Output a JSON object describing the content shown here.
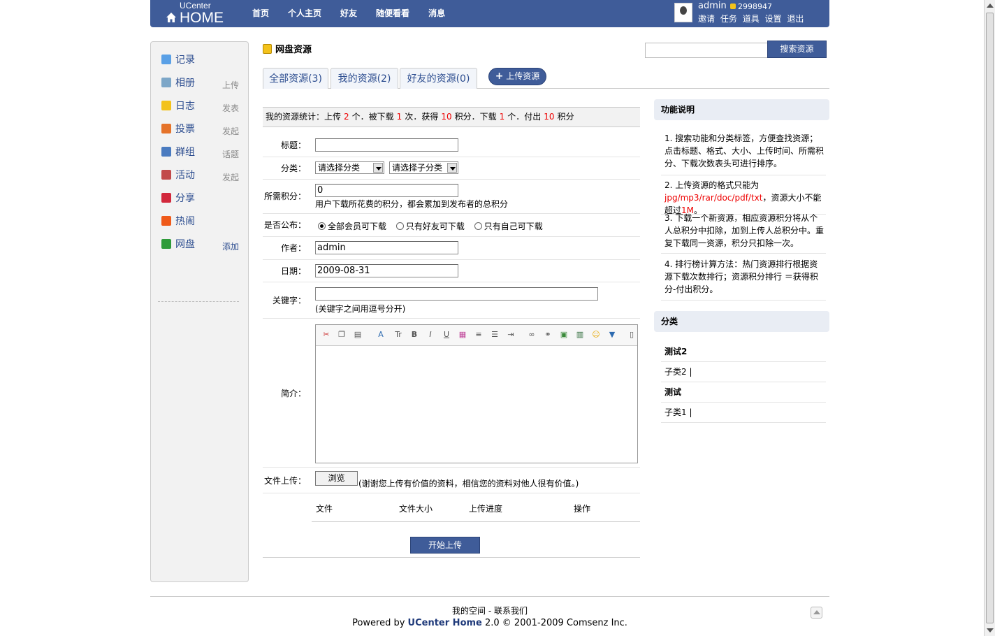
{
  "header": {
    "logo_top": "UCenter",
    "logo_main": "HOME",
    "nav": [
      "首页",
      "个人主页",
      "好友",
      "随便看看",
      "消息"
    ],
    "user": {
      "name": "admin",
      "credits": "2998947",
      "links": [
        "邀请",
        "任务",
        "道具",
        "设置",
        "退出"
      ]
    }
  },
  "sidebar": {
    "items": [
      {
        "label": "记录",
        "action": "",
        "icon": "speech-bubble-icon",
        "color": "#5aa0e6"
      },
      {
        "label": "相册",
        "action": "上传",
        "icon": "photo-album-icon",
        "color": "#7da7c8"
      },
      {
        "label": "日志",
        "action": "发表",
        "icon": "blog-icon",
        "color": "#f3c21b"
      },
      {
        "label": "投票",
        "action": "发起",
        "icon": "poll-chart-icon",
        "color": "#e5732a"
      },
      {
        "label": "群组",
        "action": "话题",
        "icon": "group-icon",
        "color": "#4a7bc0"
      },
      {
        "label": "活动",
        "action": "发起",
        "icon": "calendar-icon",
        "color": "#c24a4a"
      },
      {
        "label": "分享",
        "action": "",
        "icon": "share-hearts-icon",
        "color": "#d2283c"
      },
      {
        "label": "热闹",
        "action": "",
        "icon": "fire-icon",
        "color": "#ef5a1a"
      },
      {
        "label": "网盘",
        "action": "添加",
        "icon": "disk-icon",
        "color": "#2e9b3a"
      }
    ]
  },
  "page": {
    "title": "网盘资源",
    "search_button": "搜索资源",
    "tabs": [
      "全部资源(3)",
      "我的资源(2)",
      "好友的资源(0)"
    ],
    "upload_button": "上传资源"
  },
  "stats": {
    "prefix": "我的资源统计：上传",
    "uploaded": "2",
    "t1": "个．被下载",
    "downloaded_times": "1",
    "t2": "次．获得",
    "earned": "10",
    "t3": "积分．下载",
    "downloads": "1",
    "t4": "个．付出",
    "paid": "10",
    "t5": "积分"
  },
  "form": {
    "title_label": "标题：",
    "title_value": "",
    "category_label": "分类：",
    "category_select": "请选择分类",
    "subcategory_select": "请选择子分类",
    "points_label": "所需积分：",
    "points_value": "0",
    "points_hint": "用户下载所花费的积分，都会累加到发布者的总积分",
    "public_label": "是否公布：",
    "public_options": [
      "全部会员可下载",
      "只有好友可下载",
      "只有自己可下载"
    ],
    "author_label": "作者：",
    "author_value": "admin",
    "date_label": "日期：",
    "date_value": "2009-08-31",
    "keywords_label": "关键字：",
    "keywords_value": "",
    "keywords_hint": "(关键字之间用逗号分开)",
    "intro_label": "简介：",
    "file_label": "文件上传：",
    "browse_button": "浏览",
    "file_hint": "(谢谢您上传有价值的资料，相信您的资料对他人很有价值。)",
    "file_columns": [
      "文件",
      "文件大小",
      "上传进度",
      "操作"
    ],
    "start_button": "开始上传",
    "editor_buttons": [
      "cut-icon",
      "copy-icon",
      "paste-icon",
      "font-family-icon",
      "font-size-icon",
      "bold-icon",
      "italic-icon",
      "underline-icon",
      "color-icon",
      "align-icon",
      "list-icon",
      "indent-icon",
      "link-icon",
      "unlink-icon",
      "image-icon",
      "video-icon",
      "emoticon-icon",
      "save-icon",
      "source-icon"
    ]
  },
  "right": {
    "help_title": "功能说明",
    "notes": [
      "1. 搜索功能和分类标签，方便查找资源；点击标题、格式、大小、上传时间、所需积分、下载次数表头可进行排序。",
      "3. 下载一个新资源，相应资源积分将从个人总积分中扣除，加到上传人总积分中。重复下载同一资源，积分只扣除一次。",
      "4. 排行榜计算方法：热门资源排行根据资源下载次数排行；资源积分排行 ＝获得积分-付出积分。"
    ],
    "note2_a": "2. 上传资源的格式只能为",
    "note2_red1": "jpg/mp3/rar/doc/pdf/txt",
    "note2_b": "，资源大小不能超过",
    "note2_red2": "1M",
    "note2_c": "。",
    "category_title": "分类",
    "categories": [
      {
        "name": "测试2",
        "bold": true
      },
      {
        "name": "子类2 |",
        "bold": false
      },
      {
        "name": "测试",
        "bold": true
      },
      {
        "name": "子类1 |",
        "bold": false
      }
    ]
  },
  "footer": {
    "line1": "我的空间 - 联系我们",
    "line2_pre": "Powered by ",
    "line2_brand": "UCenter Home",
    "line2_post": " 2.0 © 2001-2009 Comsenz Inc."
  }
}
